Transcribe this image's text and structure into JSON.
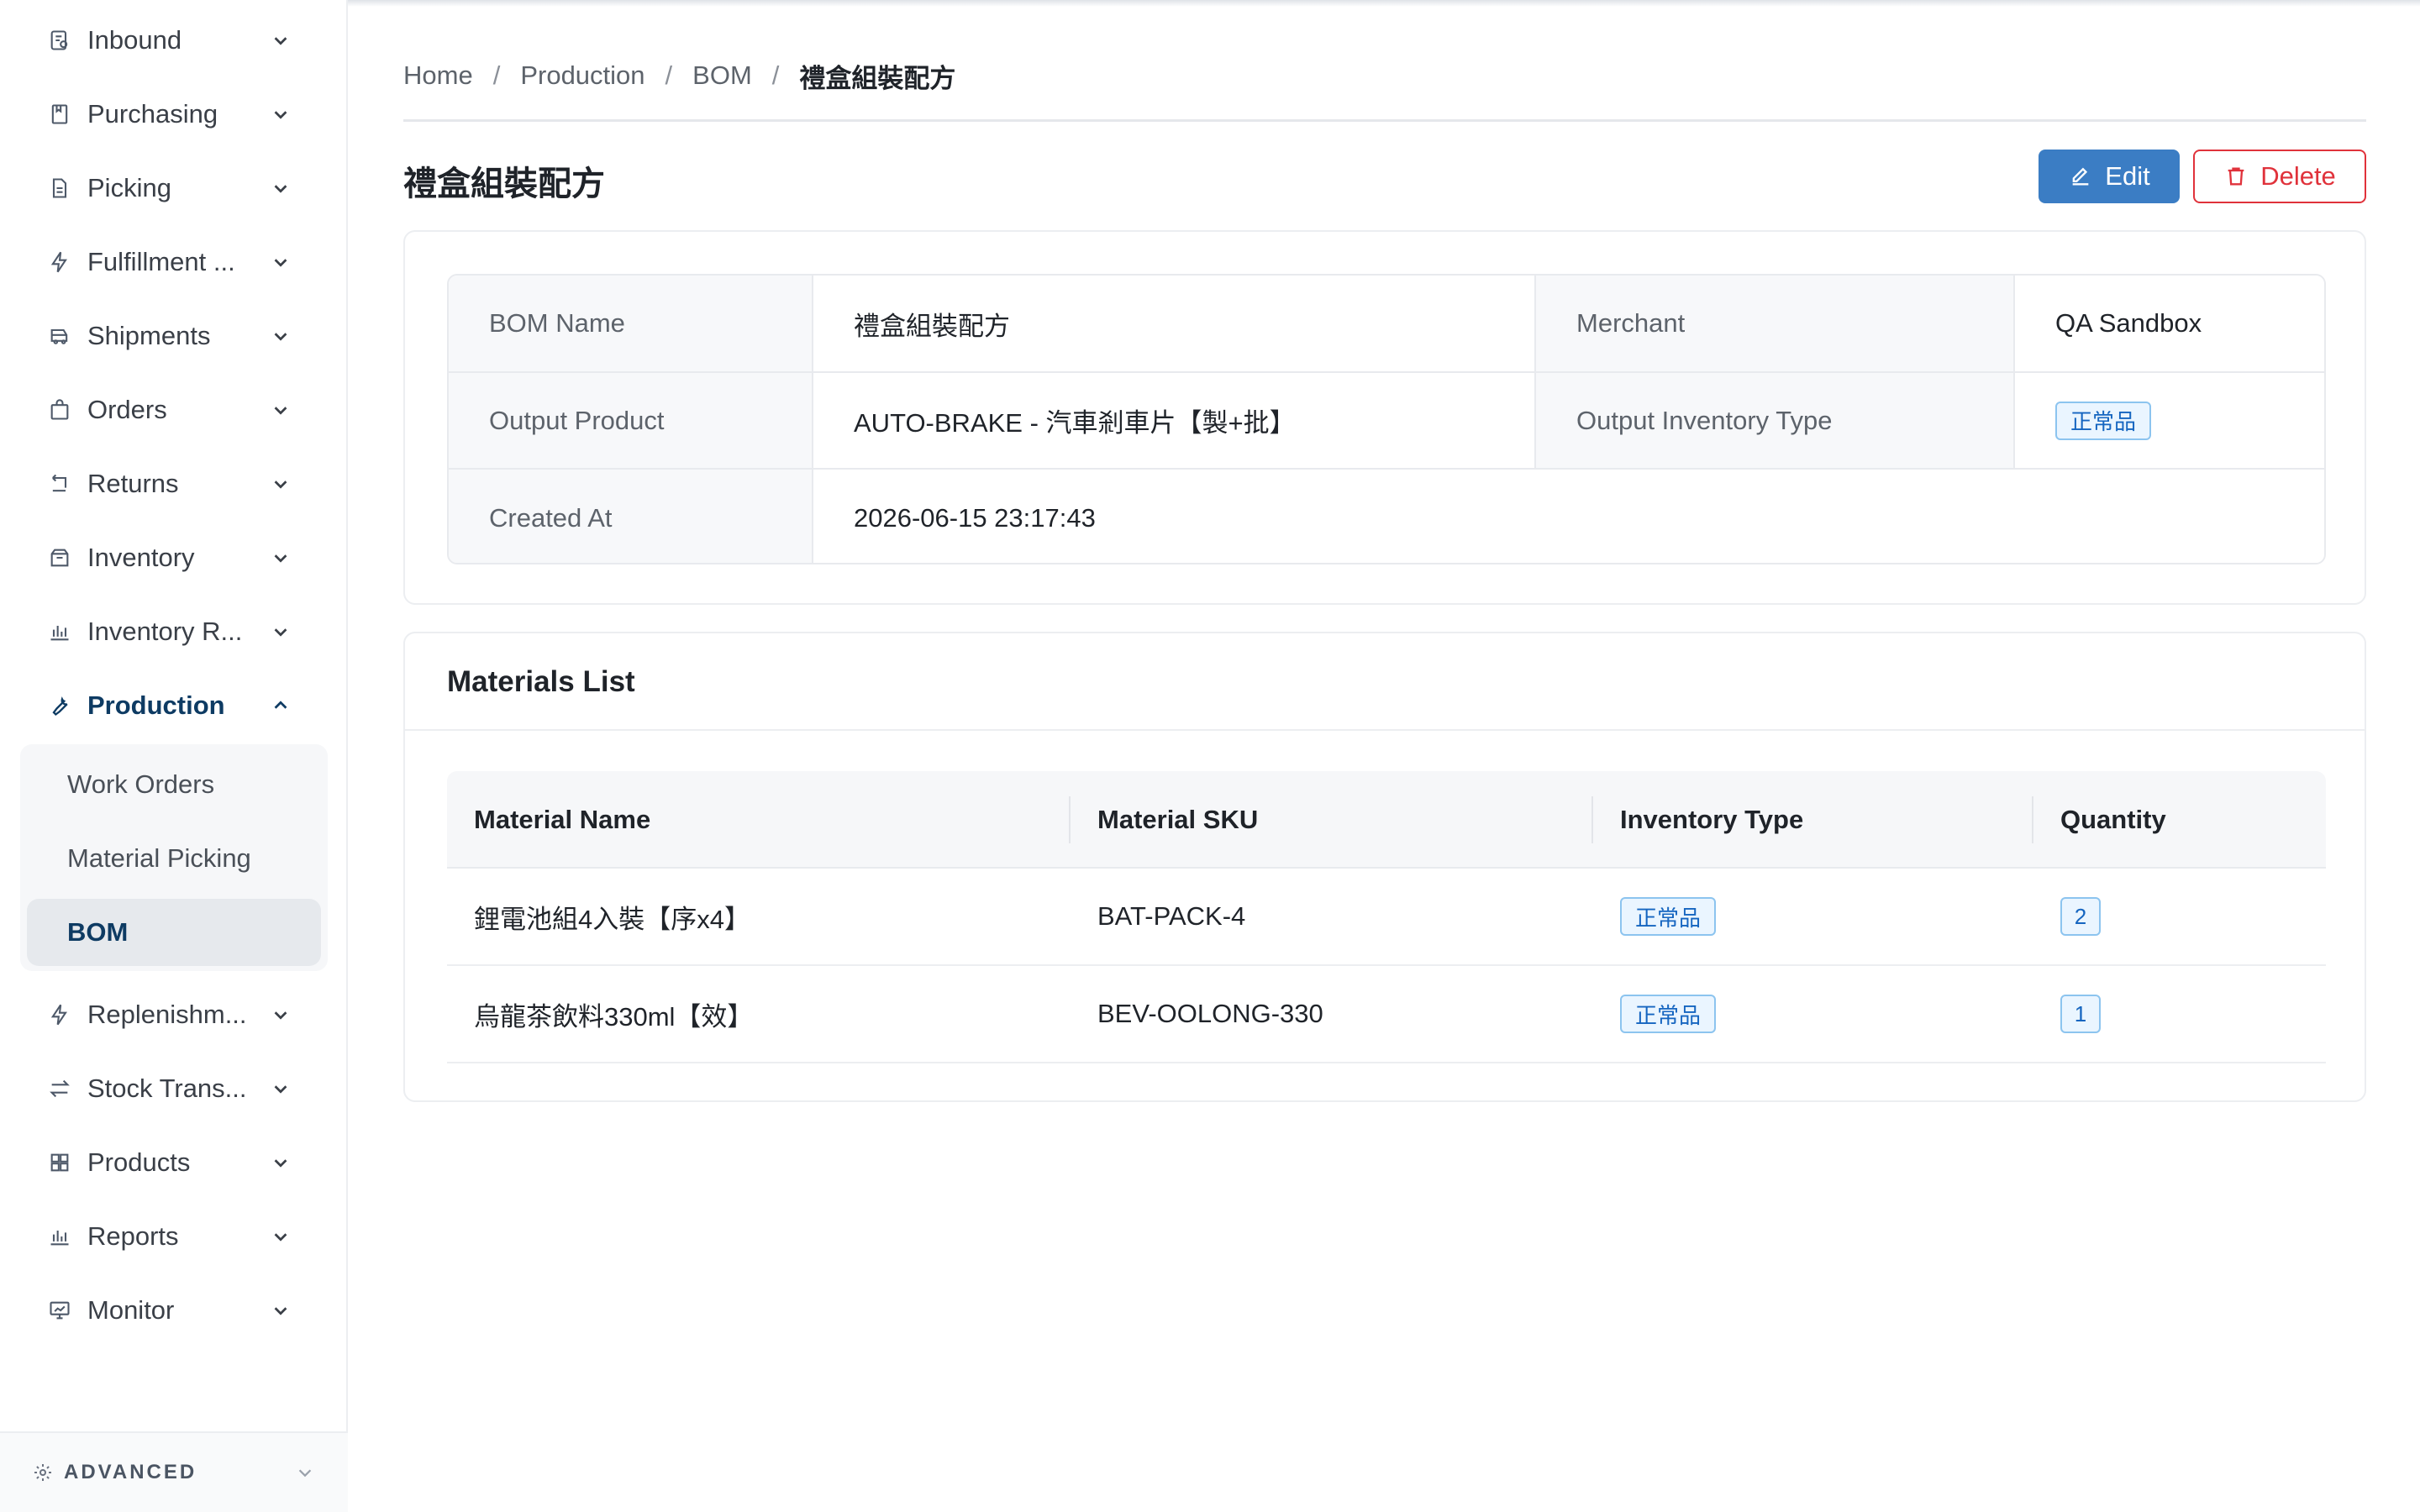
{
  "sidebar": {
    "items": [
      {
        "label": "Inbound",
        "icon": "inbound-icon"
      },
      {
        "label": "Purchasing",
        "icon": "purchasing-icon"
      },
      {
        "label": "Picking",
        "icon": "picking-icon"
      },
      {
        "label": "Fulfillment ...",
        "icon": "lightning-icon"
      },
      {
        "label": "Shipments",
        "icon": "truck-icon"
      },
      {
        "label": "Orders",
        "icon": "bag-icon"
      },
      {
        "label": "Returns",
        "icon": "return-icon"
      },
      {
        "label": "Inventory",
        "icon": "box-icon"
      },
      {
        "label": "Inventory R...",
        "icon": "bar-chart-icon"
      },
      {
        "label": "Production",
        "icon": "wrench-icon",
        "expanded": true
      },
      {
        "label": "Replenishm...",
        "icon": "lightning-icon"
      },
      {
        "label": "Stock Trans...",
        "icon": "transfer-icon"
      },
      {
        "label": "Products",
        "icon": "grid-icon"
      },
      {
        "label": "Reports",
        "icon": "bar-chart-icon"
      },
      {
        "label": "Monitor",
        "icon": "monitor-icon"
      }
    ],
    "production_submenu": [
      "Work Orders",
      "Material Picking",
      "BOM"
    ],
    "active_submenu": "BOM",
    "advanced_label": "ADVANCED"
  },
  "breadcrumb": [
    "Home",
    "Production",
    "BOM",
    "禮盒組裝配方"
  ],
  "page_title": "禮盒組裝配方",
  "actions": {
    "edit_label": "Edit",
    "delete_label": "Delete"
  },
  "details": {
    "bom_name_label": "BOM Name",
    "bom_name": "禮盒組裝配方",
    "merchant_label": "Merchant",
    "merchant": "QA Sandbox",
    "output_product_label": "Output Product",
    "output_product": "AUTO-BRAKE - 汽車剎車片【製+批】",
    "output_inventory_type_label": "Output Inventory Type",
    "output_inventory_type": "正常品",
    "created_at_label": "Created At",
    "created_at": "2026-06-15 23:17:43"
  },
  "materials": {
    "title": "Materials List",
    "columns": [
      "Material Name",
      "Material SKU",
      "Inventory Type",
      "Quantity"
    ],
    "rows": [
      {
        "name": "鋰電池組4入裝【序x4】",
        "sku": "BAT-PACK-4",
        "type": "正常品",
        "qty": "2"
      },
      {
        "name": "烏龍茶飲料330ml【效】",
        "sku": "BEV-OOLONG-330",
        "type": "正常品",
        "qty": "1"
      }
    ]
  },
  "colors": {
    "accent": "#3b7dc4",
    "danger": "#e0323b",
    "active_nav": "#0e3b63",
    "tag_blue": "#1565c0"
  }
}
